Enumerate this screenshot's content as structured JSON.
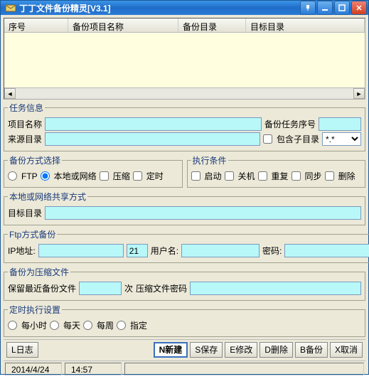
{
  "title": "丁丁文件备份精灵[V3.1]",
  "columns": {
    "c1": "序号",
    "c2": "备份项目名称",
    "c3": "备份目录",
    "c4": "目标目录"
  },
  "task_info": {
    "legend": "任务信息",
    "name_lbl": "项目名称",
    "seq_lbl": "备份任务序号",
    "src_lbl": "来源目录",
    "subdir_lbl": "包含子目录",
    "pattern": "*.*"
  },
  "method": {
    "legend": "备份方式选择",
    "ftp": "FTP",
    "local": "本地或网络",
    "zip": "压缩",
    "sched": "定时"
  },
  "exec": {
    "legend": "执行条件",
    "start": "启动",
    "shut": "关机",
    "repeat": "重复",
    "sync": "同步",
    "del": "删除"
  },
  "share": {
    "legend": "本地或网络共享方式",
    "target": "目标目录"
  },
  "ftp": {
    "legend": "Ftp方式备份",
    "ip": "IP地址:",
    "port": "21",
    "user": "用户名:",
    "pass": "密码:"
  },
  "zip": {
    "legend": "备份为压缩文件",
    "keep": "保留最近备份文件",
    "ci": "次",
    "zpass": "压缩文件密码"
  },
  "sched": {
    "legend": "定时执行设置",
    "h": "每小时",
    "d": "每天",
    "w": "每周",
    "sp": "指定"
  },
  "buttons": {
    "log": "L日志",
    "new": "N新建",
    "save": "S保存",
    "edit": "E修改",
    "del": "D删除",
    "back": "B备份",
    "cancel": "X取消"
  },
  "status": {
    "date": "2014/4/24",
    "time": "14:57"
  }
}
